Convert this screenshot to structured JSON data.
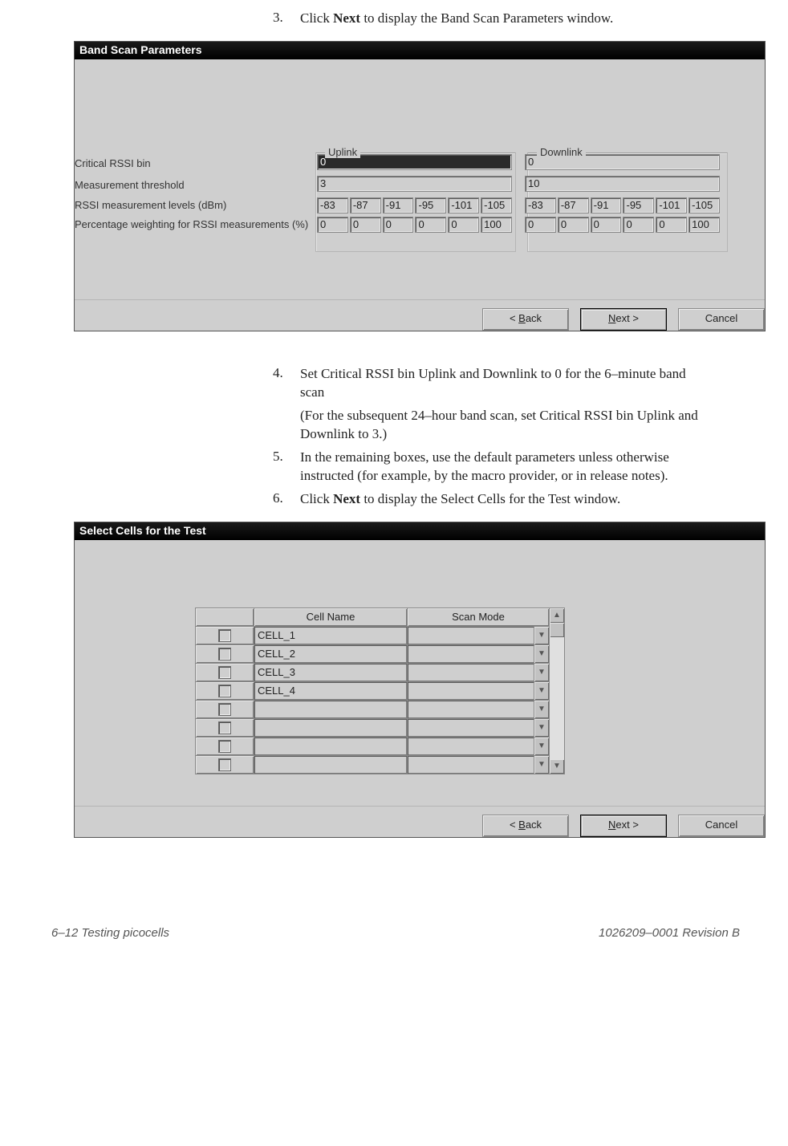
{
  "instructions": {
    "step3": {
      "num": "3.",
      "pre": "Click ",
      "bold": "Next",
      "post": " to display the Band Scan Parameters window."
    },
    "step4": {
      "num": "4.",
      "line1": "Set Critical RSSI bin Uplink and Downlink to 0 for the 6–minute band scan",
      "line2": "(For the subsequent 24–hour band scan, set Critical RSSI bin Uplink and Downlink to 3.)"
    },
    "step5": {
      "num": "5.",
      "text": "In the remaining boxes, use the default parameters unless otherwise instructed (for example, by the macro provider, or in release notes)."
    },
    "step6": {
      "num": "6.",
      "pre": "Click ",
      "bold": "Next",
      "post": " to display the Select Cells for the Test window."
    }
  },
  "dialog1": {
    "title": "Band Scan Parameters",
    "uplink_legend": "Uplink",
    "downlink_legend": "Downlink",
    "rows": {
      "critical": "Critical RSSI bin",
      "threshold": "Measurement threshold",
      "levels": "RSSI measurement levels (dBm)",
      "weights": "Percentage weighting for RSSI measurements (%)"
    },
    "uplink": {
      "critical": "0",
      "threshold": "3",
      "levels": [
        "-83",
        "-87",
        "-91",
        "-95",
        "-101",
        "-105"
      ],
      "weights": [
        "0",
        "0",
        "0",
        "0",
        "0",
        "100"
      ]
    },
    "downlink": {
      "critical": "0",
      "threshold": "10",
      "levels": [
        "-83",
        "-87",
        "-91",
        "-95",
        "-101",
        "-105"
      ],
      "weights": [
        "0",
        "0",
        "0",
        "0",
        "0",
        "100"
      ]
    },
    "buttons": {
      "back_pre": "< ",
      "back_u": "B",
      "back_post": "ack",
      "next_u": "N",
      "next_post": "ext >",
      "cancel": "Cancel"
    }
  },
  "dialog2": {
    "title": "Select Cells for the Test",
    "headers": {
      "cellname": "Cell Name",
      "scanmode": "Scan Mode"
    },
    "rows": [
      {
        "name": "CELL_1"
      },
      {
        "name": "CELL_2"
      },
      {
        "name": "CELL_3"
      },
      {
        "name": "CELL_4"
      },
      {
        "name": ""
      },
      {
        "name": ""
      },
      {
        "name": ""
      },
      {
        "name": ""
      }
    ],
    "buttons": {
      "back_pre": "< ",
      "back_u": "B",
      "back_post": "ack",
      "next_u": "N",
      "next_post": "ext >",
      "cancel": "Cancel"
    }
  },
  "footer": {
    "left": "6–12  Testing picocells",
    "right": "1026209–0001  Revision B"
  }
}
